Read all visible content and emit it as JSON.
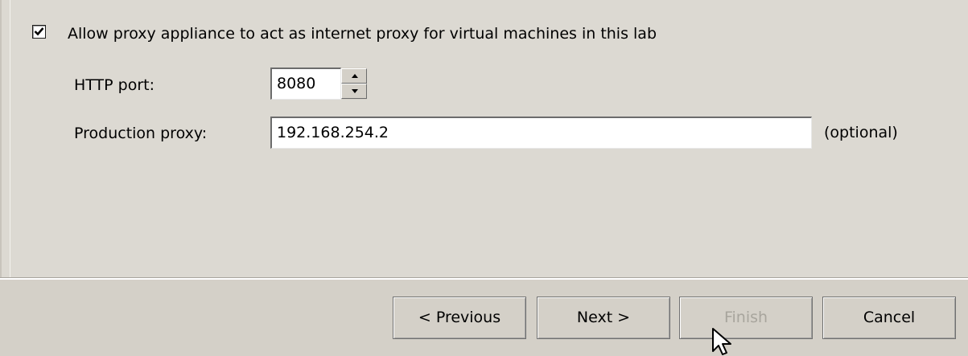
{
  "proxy": {
    "allow_checked": true,
    "allow_label": "Allow proxy appliance to act as internet proxy for virtual machines in this lab",
    "http_port_label": "HTTP port:",
    "http_port_value": "8080",
    "production_proxy_label": "Production proxy:",
    "production_proxy_value": "192.168.254.2",
    "optional_label": "(optional)"
  },
  "buttons": {
    "previous_label": "< Previous",
    "next_label": "Next >",
    "finish_label": "Finish",
    "cancel_label": "Cancel"
  },
  "icons": {
    "checkbox": "checkmark-icon",
    "spinner_up": "spin-up-arrow-icon",
    "spinner_down": "spin-down-arrow-icon",
    "cursor": "mouse-pointer-icon"
  },
  "colors": {
    "dialog_background": "#d4d0c8",
    "disabled_text": "#a8a59d"
  }
}
